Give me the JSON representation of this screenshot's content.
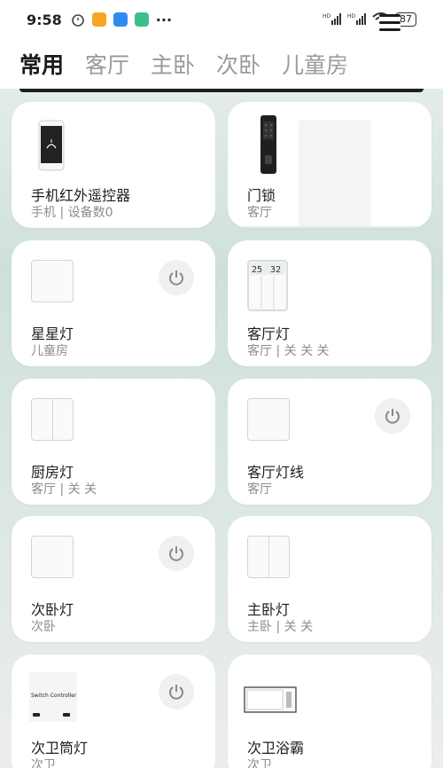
{
  "status": {
    "time": "9:58",
    "battery": "87"
  },
  "tabs": [
    "常用",
    "客厅",
    "主卧",
    "次卧",
    "儿童房"
  ],
  "cards": [
    {
      "name": "手机红外遥控器",
      "sub": "手机 | 设备数0"
    },
    {
      "name": "门锁",
      "sub": "客厅"
    },
    {
      "name": "星星灯",
      "sub": "儿童房"
    },
    {
      "name": "客厅灯",
      "sub": "客厅 | 关 关 关"
    },
    {
      "name": "厨房灯",
      "sub": "客厅 | 关 关"
    },
    {
      "name": "客厅灯线",
      "sub": "客厅"
    },
    {
      "name": "次卧灯",
      "sub": "次卧"
    },
    {
      "name": "主卧灯",
      "sub": "主卧 | 关 关"
    },
    {
      "name": "次卫筒灯",
      "sub": "次卫"
    },
    {
      "name": "次卫浴霸",
      "sub": "次卫"
    }
  ],
  "switch_controller_text": "Switch Controller",
  "lcd": {
    "left": "25",
    "right": "32"
  },
  "colors": {
    "accent_orange": "#f6a623",
    "accent_blue": "#2d8cf0",
    "accent_green": "#3cc08a"
  }
}
